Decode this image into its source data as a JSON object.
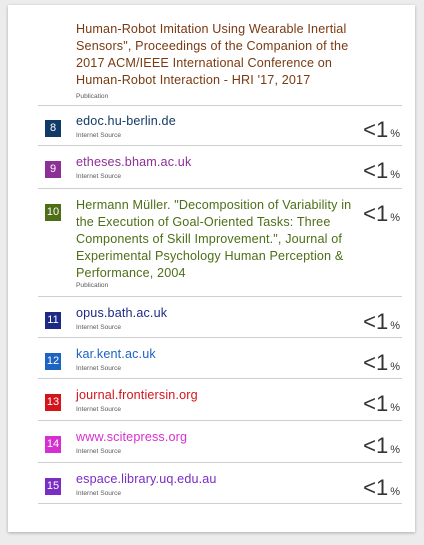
{
  "colors": {
    "background": "#ececec",
    "card": "#ffffff",
    "divider": "#cfcfcf",
    "label_gray": "#5a5a5a",
    "percent_gray": "#333333"
  },
  "sources": [
    {
      "number": "",
      "text": "Human-Robot Imitation Using Wearable Inertial Sensors\", Proceedings of the Companion of the 2017 ACM/IEEE International Conference on Human-Robot Interaction - HRI '17, 2017",
      "type": "Publication",
      "percent": "",
      "unit": "",
      "color": "#7a3a12"
    },
    {
      "number": "8",
      "text": "edoc.hu-berlin.de",
      "type": "Internet Source",
      "percent": "<1",
      "unit": "%",
      "color": "#123a66"
    },
    {
      "number": "9",
      "text": "etheses.bham.ac.uk",
      "type": "Internet Source",
      "percent": "<1",
      "unit": "%",
      "color": "#8e2f98"
    },
    {
      "number": "10",
      "text": "Hermann Müller. \"Decomposition of Variability in the Execution of Goal-Oriented Tasks: Three Components of Skill Improvement.\", Journal of Experimental Psychology Human Perception & Performance, 2004",
      "type": "Publication",
      "percent": "<1",
      "unit": "%",
      "color": "#4d6e17"
    },
    {
      "number": "11",
      "text": "opus.bath.ac.uk",
      "type": "Internet Source",
      "percent": "<1",
      "unit": "%",
      "color": "#1c2a86"
    },
    {
      "number": "12",
      "text": "kar.kent.ac.uk",
      "type": "Internet Source",
      "percent": "<1",
      "unit": "%",
      "color": "#1c63c2"
    },
    {
      "number": "13",
      "text": "journal.frontiersin.org",
      "type": "Internet Source",
      "percent": "<1",
      "unit": "%",
      "color": "#d3141b"
    },
    {
      "number": "14",
      "text": "www.scitepress.org",
      "type": "Internet Source",
      "percent": "<1",
      "unit": "%",
      "color": "#d62fd0"
    },
    {
      "number": "15",
      "text": "espace.library.uq.edu.au",
      "type": "Internet Source",
      "percent": "<1",
      "unit": "%",
      "color": "#7a2cc4"
    }
  ]
}
